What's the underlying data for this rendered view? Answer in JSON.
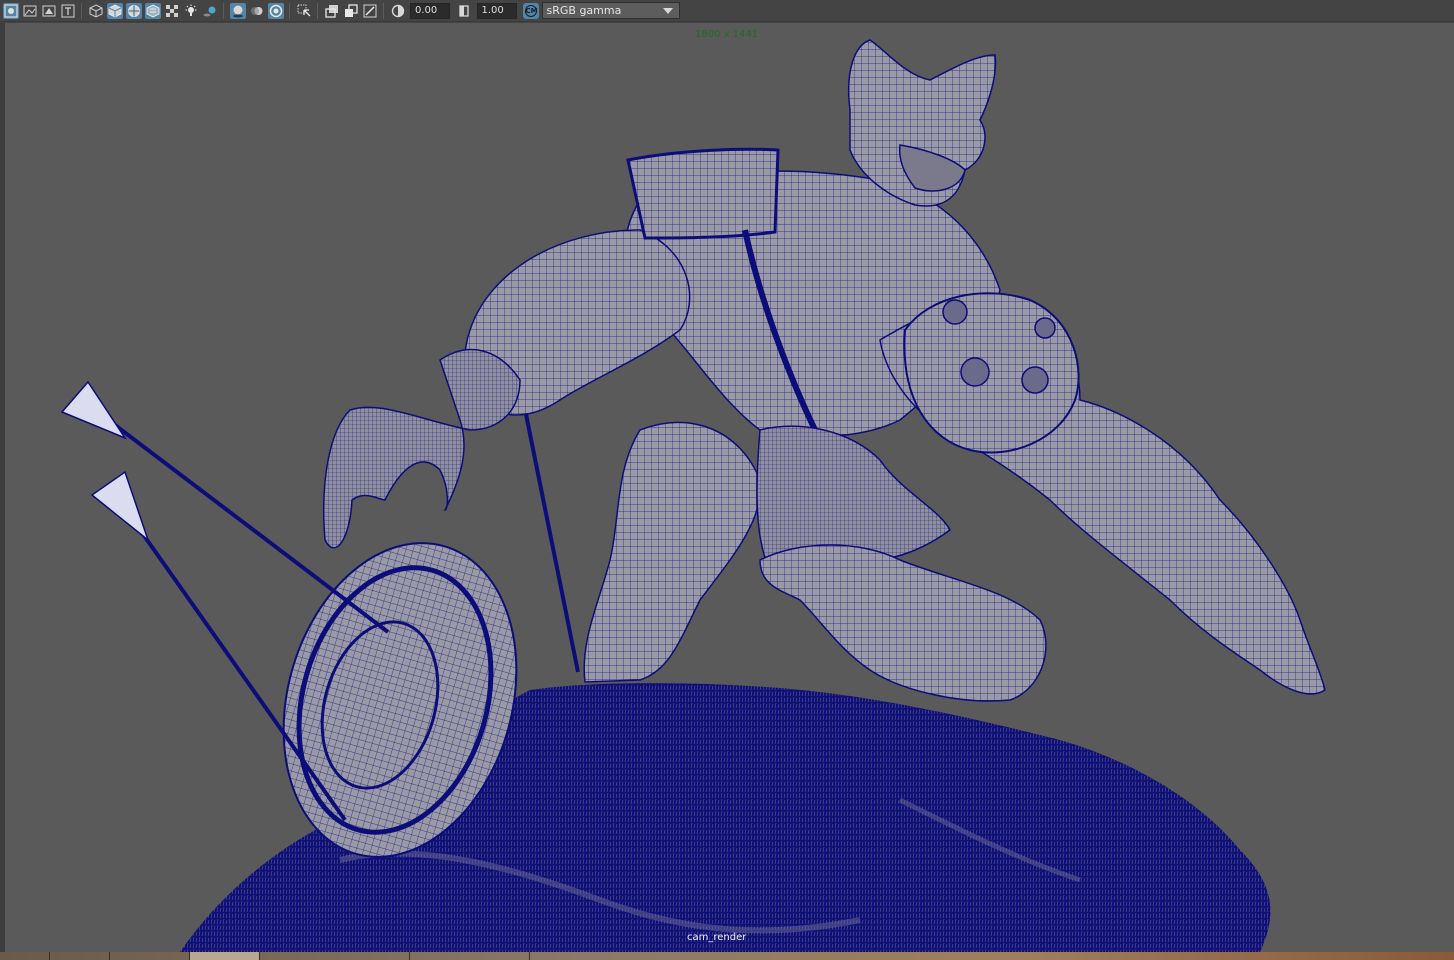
{
  "toolbar": {
    "buttons": [
      {
        "icon": "camera-attributes-icon",
        "active": true
      },
      {
        "icon": "image-plane-icon",
        "active": false
      },
      {
        "icon": "bookmark-icon",
        "active": false
      },
      {
        "icon": "text-icon",
        "active": false
      },
      {
        "icon": "wireframe-cube-icon",
        "active": false
      },
      {
        "icon": "smooth-shade-cube-icon",
        "active": true
      },
      {
        "icon": "wireframe-on-shaded-icon",
        "active": true
      },
      {
        "icon": "textured-cube-icon",
        "active": true
      },
      {
        "icon": "checker-icon",
        "active": false
      },
      {
        "icon": "light-icon",
        "active": false
      },
      {
        "icon": "shadow-icon",
        "active": false
      },
      {
        "icon": "screen-space-ao-icon",
        "active": true
      },
      {
        "icon": "motion-blur-icon",
        "active": false
      },
      {
        "icon": "anti-alias-icon",
        "active": true
      },
      {
        "icon": "isolate-select-icon",
        "active": false
      },
      {
        "icon": "xray-icon",
        "active": false
      },
      {
        "icon": "xray-joints-icon",
        "active": false
      },
      {
        "icon": "xray-components-icon",
        "active": false
      },
      {
        "icon": "exposure-icon",
        "active": false
      },
      {
        "icon": "gamma-icon",
        "active": false
      }
    ],
    "exposure_value": "0.00",
    "gamma_value": "1.00",
    "color_management_icon": "color-management-icon",
    "color_space": "sRGB gamma"
  },
  "viewport": {
    "resolution": "1800 x 1441",
    "camera": "cam_render",
    "background_color": "#5a5a5a",
    "wire_color": "#0d0d7a",
    "mesh_color": "#9a9aa6"
  }
}
